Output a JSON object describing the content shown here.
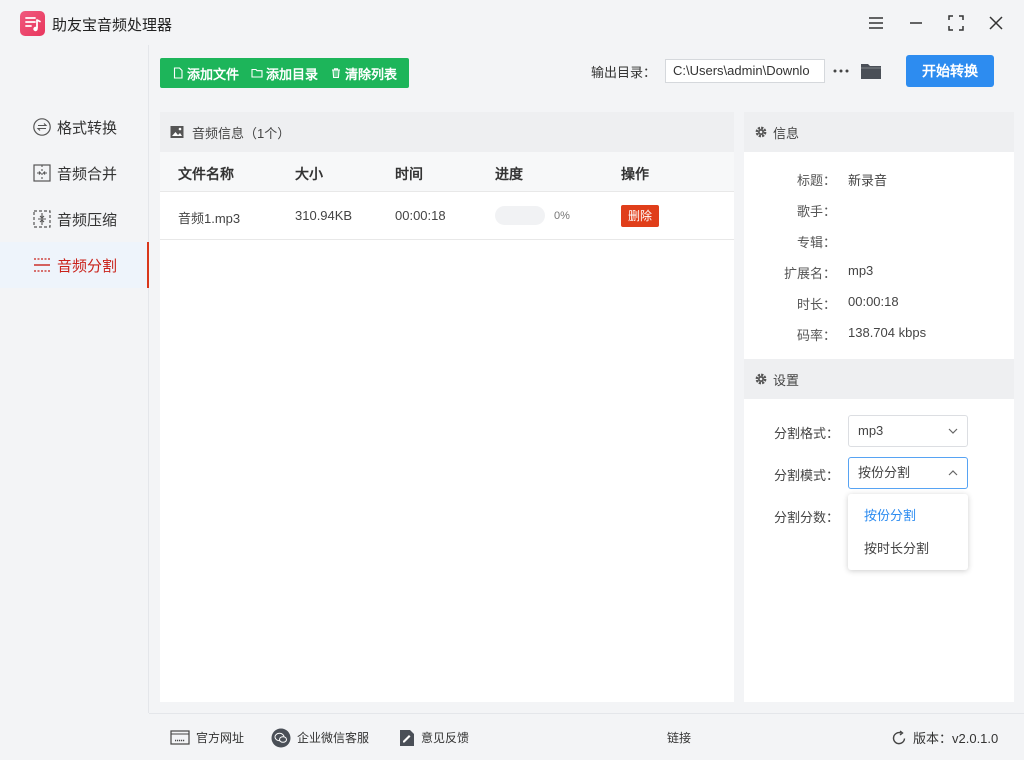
{
  "app": {
    "title": "助友宝音频处理器"
  },
  "sidebar": {
    "items": [
      {
        "label": "格式转换",
        "icon": "format-convert-icon"
      },
      {
        "label": "音频合并",
        "icon": "merge-icon"
      },
      {
        "label": "音频压缩",
        "icon": "compress-icon"
      },
      {
        "label": "音频分割",
        "icon": "split-icon",
        "active": true
      }
    ]
  },
  "toolbar": {
    "add_file": "添加文件",
    "add_dir": "添加目录",
    "clear_list": "清除列表",
    "output_label": "输出目录：",
    "output_path": "C:\\Users\\admin\\Downlo",
    "start": "开始转换"
  },
  "file_panel": {
    "title": "音频信息（1个）",
    "columns": [
      "文件名称",
      "大小",
      "时间",
      "进度",
      "操作"
    ],
    "rows": [
      {
        "name": "音频1.mp3",
        "size": "310.94KB",
        "time": "00:00:18",
        "progress_pct": 0,
        "progress_text": "0%",
        "action": "删除"
      }
    ]
  },
  "info_panel": {
    "title": "信息",
    "fields": [
      {
        "key": "标题：",
        "value": "新录音"
      },
      {
        "key": "歌手：",
        "value": ""
      },
      {
        "key": "专辑：",
        "value": ""
      },
      {
        "key": "扩展名：",
        "value": "mp3"
      },
      {
        "key": "时长：",
        "value": "00:00:18"
      },
      {
        "key": "码率：",
        "value": "138.704 kbps"
      }
    ]
  },
  "settings_panel": {
    "title": "设置",
    "format_label": "分割格式：",
    "format_value": "mp3",
    "mode_label": "分割模式：",
    "mode_value": "按份分割",
    "count_label": "分割分数：",
    "mode_options": [
      "按份分割",
      "按时长分割"
    ]
  },
  "footer": {
    "website": "官方网址",
    "wechat": "企业微信客服",
    "feedback": "意见反馈",
    "link": "链接",
    "version": "版本：v2.0.1.0"
  },
  "colors": {
    "green": "#1db55a",
    "blue": "#2d8cf0",
    "red": "#e03e1a",
    "active_red": "#c9221a"
  }
}
